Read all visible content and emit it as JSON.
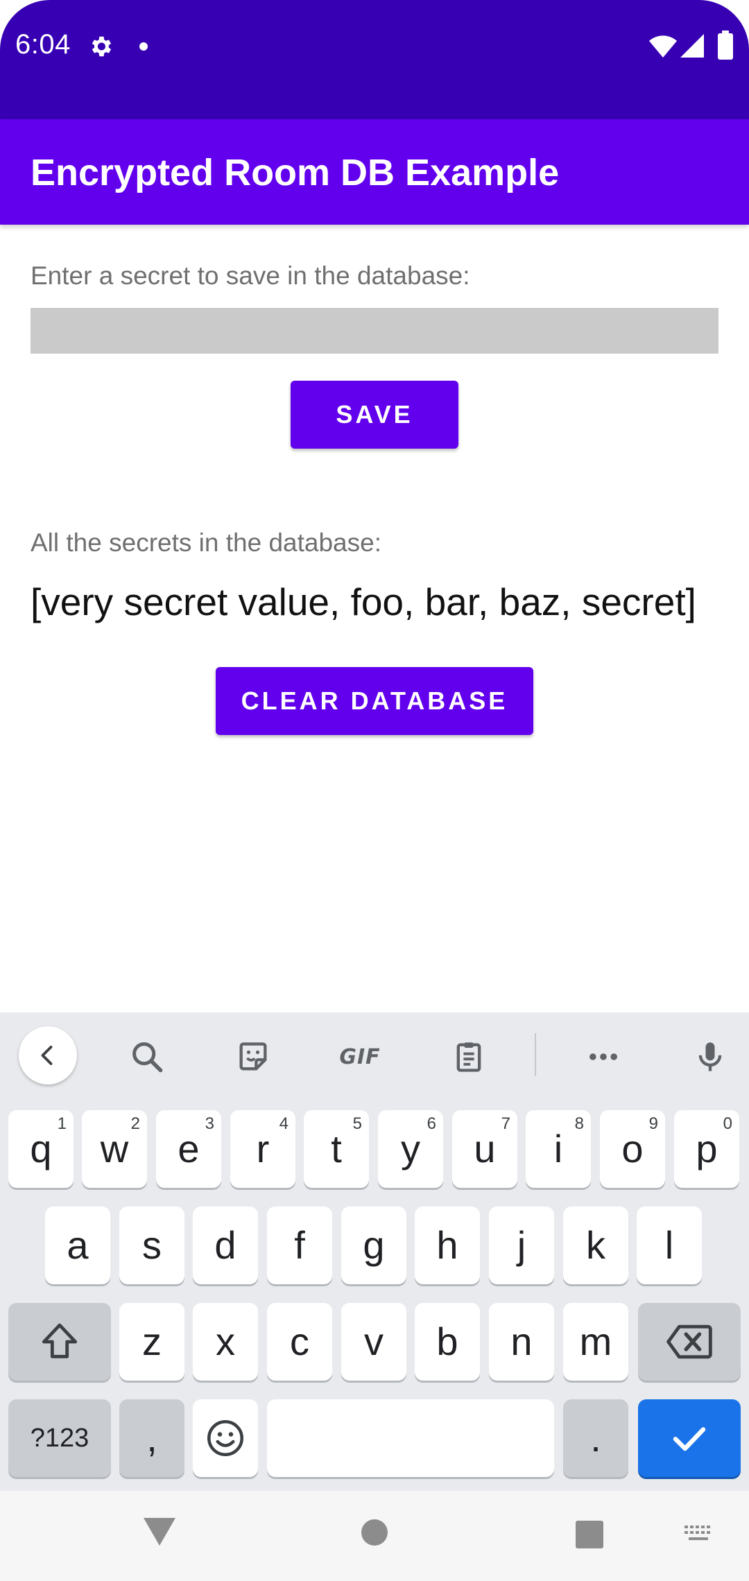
{
  "status_bar": {
    "time": "6:04"
  },
  "app_bar": {
    "title": "Encrypted Room DB Example"
  },
  "main": {
    "input_label": "Enter a secret to save in the database:",
    "input_value": "",
    "save_label": "SAVE",
    "list_label": "All the secrets in the database:",
    "secrets_text": "[very secret value, foo, bar, baz, secret]",
    "clear_label": "CLEAR DATABASE"
  },
  "keyboard": {
    "toolbar": {
      "gif_label": "GIF"
    },
    "row1": [
      {
        "label": "q",
        "hint": "1"
      },
      {
        "label": "w",
        "hint": "2"
      },
      {
        "label": "e",
        "hint": "3"
      },
      {
        "label": "r",
        "hint": "4"
      },
      {
        "label": "t",
        "hint": "5"
      },
      {
        "label": "y",
        "hint": "6"
      },
      {
        "label": "u",
        "hint": "7"
      },
      {
        "label": "i",
        "hint": "8"
      },
      {
        "label": "o",
        "hint": "9"
      },
      {
        "label": "p",
        "hint": "0"
      }
    ],
    "row2": [
      "a",
      "s",
      "d",
      "f",
      "g",
      "h",
      "j",
      "k",
      "l"
    ],
    "row3": [
      "z",
      "x",
      "c",
      "v",
      "b",
      "n",
      "m"
    ],
    "row4": {
      "symbols": "?123",
      "comma": ",",
      "period": "."
    }
  },
  "colors": {
    "status_bar": "#3700b3",
    "primary": "#6200ee",
    "enter_key": "#1a73e8"
  },
  "icons": {
    "status": [
      "gear-icon",
      "notification-dot-icon",
      "wifi-icon",
      "signal-icon",
      "battery-icon"
    ],
    "toolbar": [
      "chevron-left-icon",
      "search-icon",
      "sticker-icon",
      "gif-icon",
      "clipboard-icon",
      "more-icon",
      "microphone-icon"
    ],
    "keys": [
      "shift-icon",
      "backspace-icon",
      "emoji-icon",
      "check-icon"
    ],
    "nav": [
      "back-triangle-icon",
      "home-circle-icon",
      "recents-square-icon",
      "keyboard-switch-icon"
    ]
  }
}
